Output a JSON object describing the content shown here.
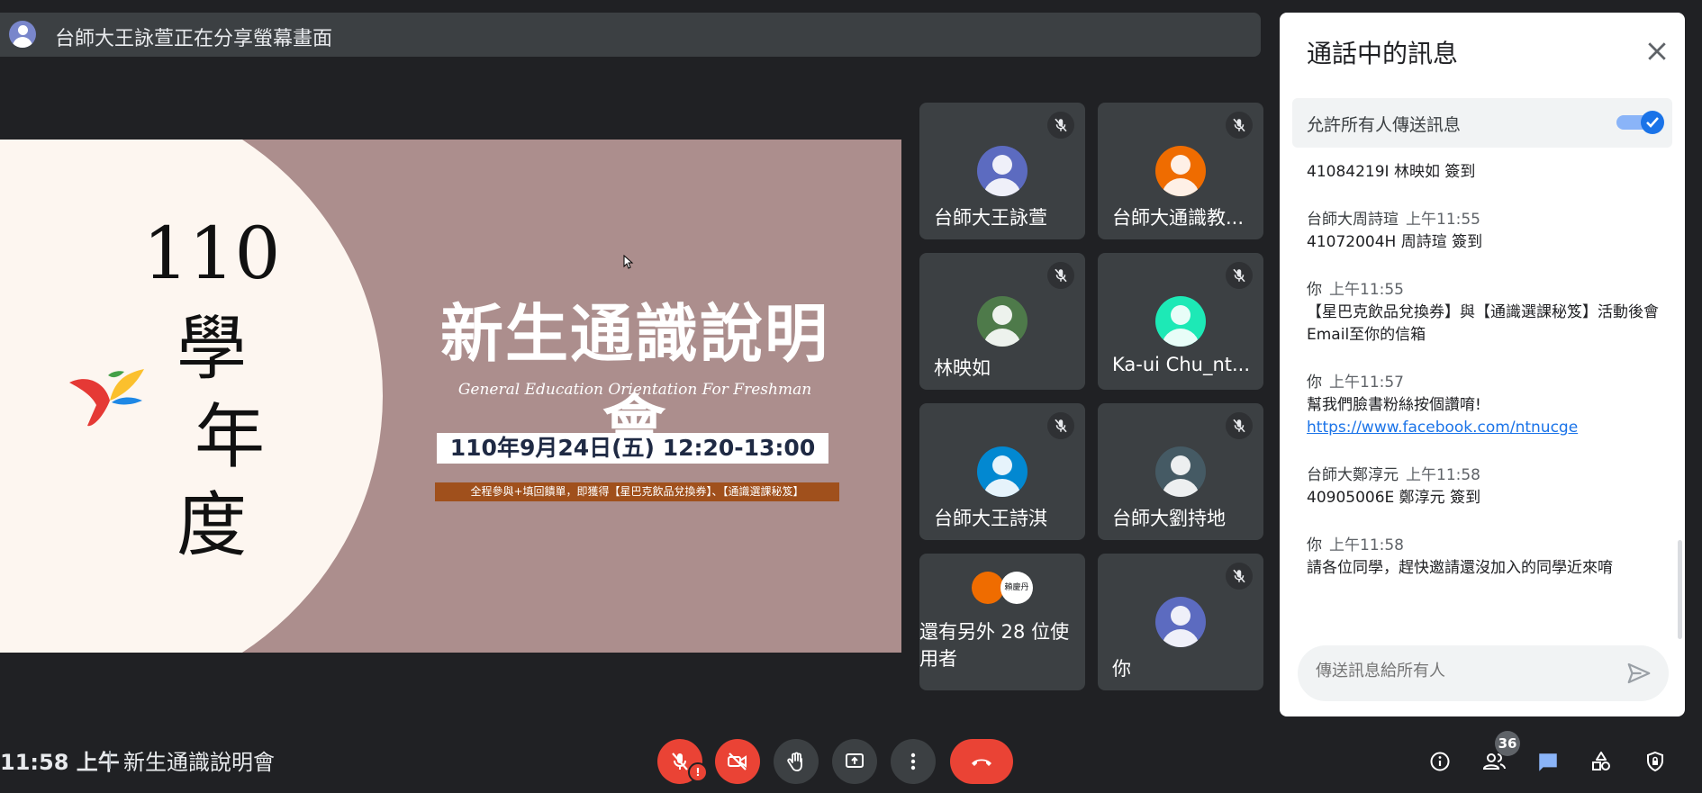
{
  "banner": {
    "text": "台師大王詠萱正在分享螢幕畫面"
  },
  "slide": {
    "vertical_year": "110",
    "vertical_chars": [
      "學",
      "年",
      "度"
    ],
    "title": "新生通識說明會",
    "subtitle": "General Education Orientation For Freshman",
    "date": "110年9月24日(五)  12:20-13:00",
    "notice": "全程參與+填回饋單，即獲得【星巴克飲品兌換券】、【通識選課秘笈】"
  },
  "tiles": [
    {
      "name": "台師大王詠萱",
      "color": "#5c6bc0"
    },
    {
      "name": "台師大通識教...",
      "color": "#ef6c00"
    },
    {
      "name": "林映如",
      "color": "#4e7a4a"
    },
    {
      "name": "Ka-ui Chu_nt...",
      "color": "#1de9b6"
    },
    {
      "name": "台師大王詩淇",
      "color": "#0288d1"
    },
    {
      "name": "台師大劉持地",
      "color": "#455a64"
    },
    {
      "name": "還有另外 28 位使用者",
      "chip": "賴慶丹"
    },
    {
      "name": "你",
      "color": "#5c6bc0"
    }
  ],
  "chat": {
    "title": "通話中的訊息",
    "allow_label": "允許所有人傳送訊息",
    "allow_on": true,
    "messages": [
      {
        "sender": "",
        "time": "",
        "text": "41084219I 林映如 簽到"
      },
      {
        "sender": "台師大周詩瑄",
        "time": "上午11:55",
        "text": "41072004H 周詩瑄 簽到"
      },
      {
        "sender": "你",
        "time": "上午11:55",
        "text": "【星巴克飲品兌換券】與【通識選課秘笈】活動後會Email至你的信箱"
      },
      {
        "sender": "你",
        "time": "上午11:57",
        "text": "幫我們臉書粉絲按個讚唷!",
        "link": "https://www.facebook.com/ntnucge"
      },
      {
        "sender": "台師大鄭淳元",
        "time": "上午11:58",
        "text": "40905006E 鄭淳元 簽到"
      },
      {
        "sender": "你",
        "time": "上午11:58",
        "text": "請各位同學，趕快邀請還沒加入的同學近來唷"
      }
    ],
    "input_placeholder": "傳送訊息給所有人"
  },
  "bottom": {
    "time": "11:58 上午",
    "meeting_name": "新生通識說明會",
    "participant_count": "36"
  },
  "colors": {
    "danger": "#ea4335",
    "accent": "#1a73e8",
    "chat_icon": "#8ab4f8"
  }
}
